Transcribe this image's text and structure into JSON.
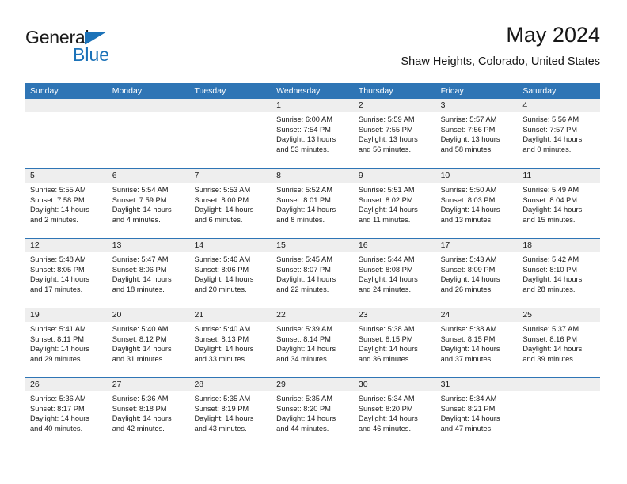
{
  "logo": {
    "word_top": "General",
    "word_bottom": "Blue",
    "accent_color": "#1b72b8"
  },
  "header": {
    "month_title": "May 2024",
    "location": "Shaw Heights, Colorado, United States",
    "header_bg_color": "#2f75b5",
    "daynum_bg_color": "#eeeeee"
  },
  "calendar": {
    "weekday_headers": [
      "Sunday",
      "Monday",
      "Tuesday",
      "Wednesday",
      "Thursday",
      "Friday",
      "Saturday"
    ],
    "weeks": [
      [
        {
          "day": "",
          "lines": []
        },
        {
          "day": "",
          "lines": []
        },
        {
          "day": "",
          "lines": []
        },
        {
          "day": "1",
          "lines": [
            "Sunrise: 6:00 AM",
            "Sunset: 7:54 PM",
            "Daylight: 13 hours",
            "and 53 minutes."
          ]
        },
        {
          "day": "2",
          "lines": [
            "Sunrise: 5:59 AM",
            "Sunset: 7:55 PM",
            "Daylight: 13 hours",
            "and 56 minutes."
          ]
        },
        {
          "day": "3",
          "lines": [
            "Sunrise: 5:57 AM",
            "Sunset: 7:56 PM",
            "Daylight: 13 hours",
            "and 58 minutes."
          ]
        },
        {
          "day": "4",
          "lines": [
            "Sunrise: 5:56 AM",
            "Sunset: 7:57 PM",
            "Daylight: 14 hours",
            "and 0 minutes."
          ]
        }
      ],
      [
        {
          "day": "5",
          "lines": [
            "Sunrise: 5:55 AM",
            "Sunset: 7:58 PM",
            "Daylight: 14 hours",
            "and 2 minutes."
          ]
        },
        {
          "day": "6",
          "lines": [
            "Sunrise: 5:54 AM",
            "Sunset: 7:59 PM",
            "Daylight: 14 hours",
            "and 4 minutes."
          ]
        },
        {
          "day": "7",
          "lines": [
            "Sunrise: 5:53 AM",
            "Sunset: 8:00 PM",
            "Daylight: 14 hours",
            "and 6 minutes."
          ]
        },
        {
          "day": "8",
          "lines": [
            "Sunrise: 5:52 AM",
            "Sunset: 8:01 PM",
            "Daylight: 14 hours",
            "and 8 minutes."
          ]
        },
        {
          "day": "9",
          "lines": [
            "Sunrise: 5:51 AM",
            "Sunset: 8:02 PM",
            "Daylight: 14 hours",
            "and 11 minutes."
          ]
        },
        {
          "day": "10",
          "lines": [
            "Sunrise: 5:50 AM",
            "Sunset: 8:03 PM",
            "Daylight: 14 hours",
            "and 13 minutes."
          ]
        },
        {
          "day": "11",
          "lines": [
            "Sunrise: 5:49 AM",
            "Sunset: 8:04 PM",
            "Daylight: 14 hours",
            "and 15 minutes."
          ]
        }
      ],
      [
        {
          "day": "12",
          "lines": [
            "Sunrise: 5:48 AM",
            "Sunset: 8:05 PM",
            "Daylight: 14 hours",
            "and 17 minutes."
          ]
        },
        {
          "day": "13",
          "lines": [
            "Sunrise: 5:47 AM",
            "Sunset: 8:06 PM",
            "Daylight: 14 hours",
            "and 18 minutes."
          ]
        },
        {
          "day": "14",
          "lines": [
            "Sunrise: 5:46 AM",
            "Sunset: 8:06 PM",
            "Daylight: 14 hours",
            "and 20 minutes."
          ]
        },
        {
          "day": "15",
          "lines": [
            "Sunrise: 5:45 AM",
            "Sunset: 8:07 PM",
            "Daylight: 14 hours",
            "and 22 minutes."
          ]
        },
        {
          "day": "16",
          "lines": [
            "Sunrise: 5:44 AM",
            "Sunset: 8:08 PM",
            "Daylight: 14 hours",
            "and 24 minutes."
          ]
        },
        {
          "day": "17",
          "lines": [
            "Sunrise: 5:43 AM",
            "Sunset: 8:09 PM",
            "Daylight: 14 hours",
            "and 26 minutes."
          ]
        },
        {
          "day": "18",
          "lines": [
            "Sunrise: 5:42 AM",
            "Sunset: 8:10 PM",
            "Daylight: 14 hours",
            "and 28 minutes."
          ]
        }
      ],
      [
        {
          "day": "19",
          "lines": [
            "Sunrise: 5:41 AM",
            "Sunset: 8:11 PM",
            "Daylight: 14 hours",
            "and 29 minutes."
          ]
        },
        {
          "day": "20",
          "lines": [
            "Sunrise: 5:40 AM",
            "Sunset: 8:12 PM",
            "Daylight: 14 hours",
            "and 31 minutes."
          ]
        },
        {
          "day": "21",
          "lines": [
            "Sunrise: 5:40 AM",
            "Sunset: 8:13 PM",
            "Daylight: 14 hours",
            "and 33 minutes."
          ]
        },
        {
          "day": "22",
          "lines": [
            "Sunrise: 5:39 AM",
            "Sunset: 8:14 PM",
            "Daylight: 14 hours",
            "and 34 minutes."
          ]
        },
        {
          "day": "23",
          "lines": [
            "Sunrise: 5:38 AM",
            "Sunset: 8:15 PM",
            "Daylight: 14 hours",
            "and 36 minutes."
          ]
        },
        {
          "day": "24",
          "lines": [
            "Sunrise: 5:38 AM",
            "Sunset: 8:15 PM",
            "Daylight: 14 hours",
            "and 37 minutes."
          ]
        },
        {
          "day": "25",
          "lines": [
            "Sunrise: 5:37 AM",
            "Sunset: 8:16 PM",
            "Daylight: 14 hours",
            "and 39 minutes."
          ]
        }
      ],
      [
        {
          "day": "26",
          "lines": [
            "Sunrise: 5:36 AM",
            "Sunset: 8:17 PM",
            "Daylight: 14 hours",
            "and 40 minutes."
          ]
        },
        {
          "day": "27",
          "lines": [
            "Sunrise: 5:36 AM",
            "Sunset: 8:18 PM",
            "Daylight: 14 hours",
            "and 42 minutes."
          ]
        },
        {
          "day": "28",
          "lines": [
            "Sunrise: 5:35 AM",
            "Sunset: 8:19 PM",
            "Daylight: 14 hours",
            "and 43 minutes."
          ]
        },
        {
          "day": "29",
          "lines": [
            "Sunrise: 5:35 AM",
            "Sunset: 8:20 PM",
            "Daylight: 14 hours",
            "and 44 minutes."
          ]
        },
        {
          "day": "30",
          "lines": [
            "Sunrise: 5:34 AM",
            "Sunset: 8:20 PM",
            "Daylight: 14 hours",
            "and 46 minutes."
          ]
        },
        {
          "day": "31",
          "lines": [
            "Sunrise: 5:34 AM",
            "Sunset: 8:21 PM",
            "Daylight: 14 hours",
            "and 47 minutes."
          ]
        },
        {
          "day": "",
          "lines": []
        }
      ]
    ]
  }
}
